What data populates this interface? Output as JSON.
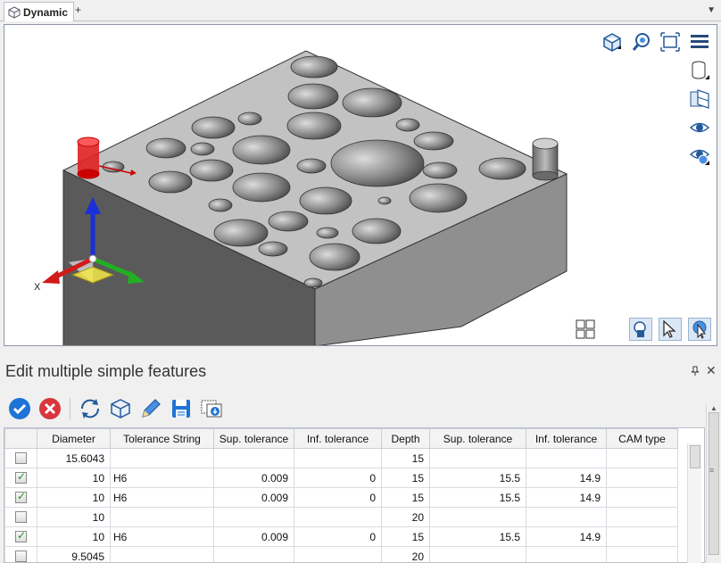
{
  "tabs": {
    "active_label": "Dynamic",
    "add_label": "+",
    "menu_label": "▼"
  },
  "viewport": {
    "axis_label_x": "X",
    "tools_right": [
      "view-cube-icon",
      "zoom-extents-icon",
      "fit-window-icon",
      "menu-icon",
      "cylinder-icon",
      "section-view-icon",
      "visibility-icon",
      "hide-icon"
    ],
    "tools_bottom": [
      "quad-view-icon",
      "pan-select-icon",
      "pointer-icon",
      "rotate-select-icon"
    ]
  },
  "panel": {
    "title": "Edit multiple simple features",
    "pin_label": "📌",
    "close_label": "✕",
    "toolbar": [
      "ok-icon",
      "cancel-icon",
      "refresh-icon",
      "cube-icon",
      "edit-pencil-icon",
      "save-icon",
      "export-icon"
    ]
  },
  "table": {
    "columns": [
      "",
      "Diameter",
      "Tolerance String",
      "Sup. tolerance",
      "Inf. tolerance",
      "Depth",
      "Sup. tolerance",
      "Inf. tolerance",
      "CAM type"
    ],
    "rows": [
      {
        "checked": false,
        "cells": [
          "15.6043",
          "",
          "",
          "",
          "15",
          "",
          "",
          ""
        ]
      },
      {
        "checked": true,
        "cells": [
          "10",
          "H6",
          "0.009",
          "0",
          "15",
          "15.5",
          "14.9",
          ""
        ]
      },
      {
        "checked": true,
        "cells": [
          "10",
          "H6",
          "0.009",
          "0",
          "15",
          "15.5",
          "14.9",
          ""
        ]
      },
      {
        "checked": false,
        "cells": [
          "10",
          "",
          "",
          "",
          "20",
          "",
          "",
          ""
        ]
      },
      {
        "checked": true,
        "cells": [
          "10",
          "H6",
          "0.009",
          "0",
          "15",
          "15.5",
          "14.9",
          ""
        ]
      },
      {
        "checked": false,
        "cells": [
          "9.5045",
          "",
          "",
          "",
          "20",
          "",
          "",
          ""
        ]
      }
    ]
  },
  "colors": {
    "accent": "#1e73d6",
    "cancel": "#d9363e",
    "check": "#1f8e1f",
    "model": "#bdbdbd"
  }
}
